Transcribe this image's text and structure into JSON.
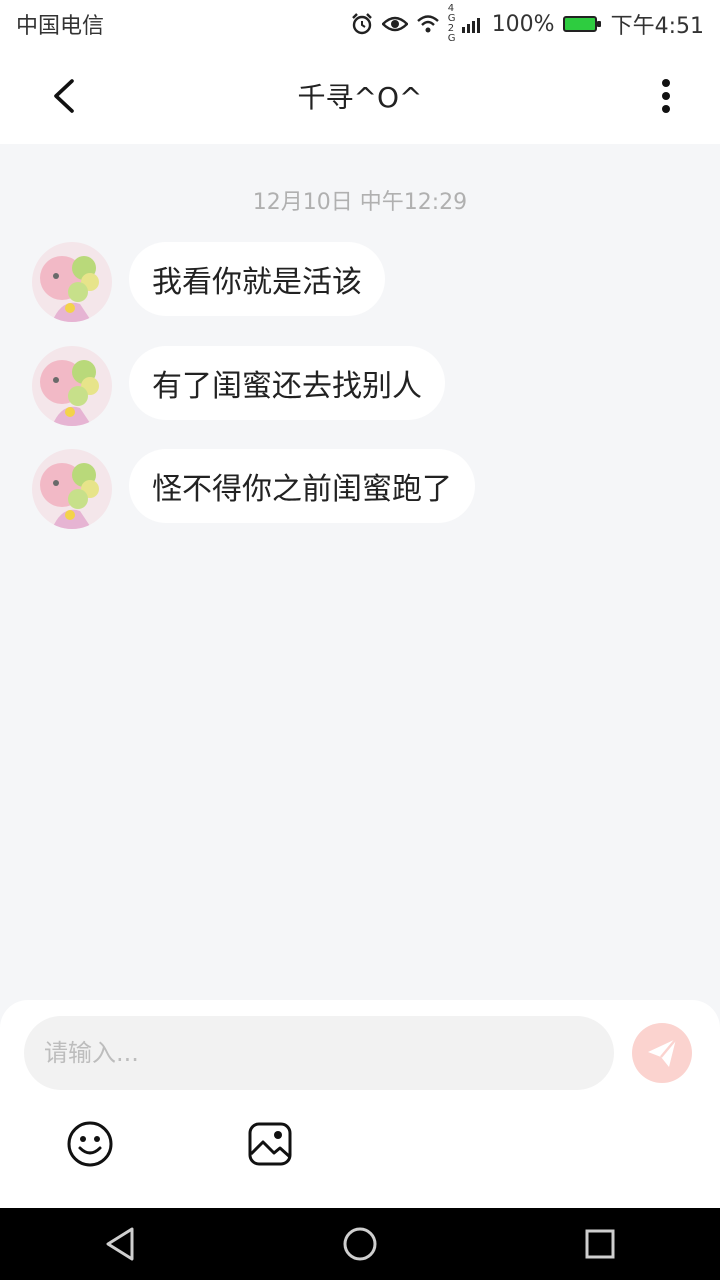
{
  "status_bar": {
    "carrier": "中国电信",
    "network": "4G 2G",
    "battery": "100%",
    "time": "下午4:51",
    "icons": [
      "alarm-icon",
      "eye-icon",
      "wifi-icon",
      "signal-icon",
      "battery-icon"
    ]
  },
  "header": {
    "title": "千寻^O^",
    "back_icon": "chevron-left-icon",
    "more_icon": "more-vertical-icon"
  },
  "chat": {
    "timestamp": "12月10日 中午12:29",
    "messages": [
      {
        "text": "我看你就是活该"
      },
      {
        "text": "有了闺蜜还去找别人"
      },
      {
        "text": "怪不得你之前闺蜜跑了"
      }
    ]
  },
  "input": {
    "placeholder": "请输入...",
    "value": "",
    "send_icon": "send-icon",
    "emoji_icon": "emoji-icon",
    "image_icon": "image-icon"
  },
  "nav": {
    "icons": [
      "nav-back-icon",
      "nav-home-icon",
      "nav-recent-icon"
    ]
  },
  "colors": {
    "background": "#f5f6f8",
    "bubble": "#ffffff",
    "send_button": "#fbd3cf",
    "timestamp": "#b0b0b0",
    "battery": "#2ecc40"
  }
}
